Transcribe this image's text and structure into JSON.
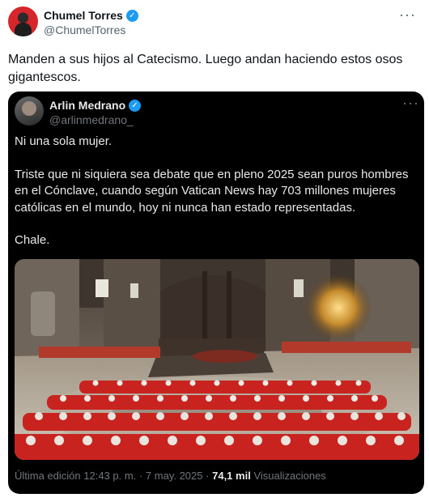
{
  "outer_tweet": {
    "author_name": "Chumel Torres",
    "handle": "@ChumelTorres",
    "more_icon": "more-horizontal-icon",
    "text": "Manden a sus hijos al Catecismo. Luego andan haciendo estos osos gigantescos."
  },
  "quoted_tweet": {
    "author_name": "Arlin Medrano",
    "handle": "@arlinmedrano_",
    "more_icon": "more-horizontal-icon",
    "paragraphs": [
      "Ni una sola mujer.",
      "Triste que ni siquiera sea debate que en pleno 2025 sean puros hombres en el Cónclave, cuando según Vatican News hay 703 millones mujeres católicas en el mundo, hoy ni nunca han estado representadas.",
      "Chale."
    ],
    "image_icon": "conclave-photo",
    "footer": {
      "edited_label": "Última edición",
      "time": "12:43 p. m.",
      "separator": "·",
      "date": "7 may. 2025",
      "views_count": "74,1 mil",
      "views_label": "Visualizaciones"
    }
  },
  "colors": {
    "verified_blue": "#1d9bf0",
    "quote_background": "#000000",
    "cardinal_red": "#c8231f"
  }
}
